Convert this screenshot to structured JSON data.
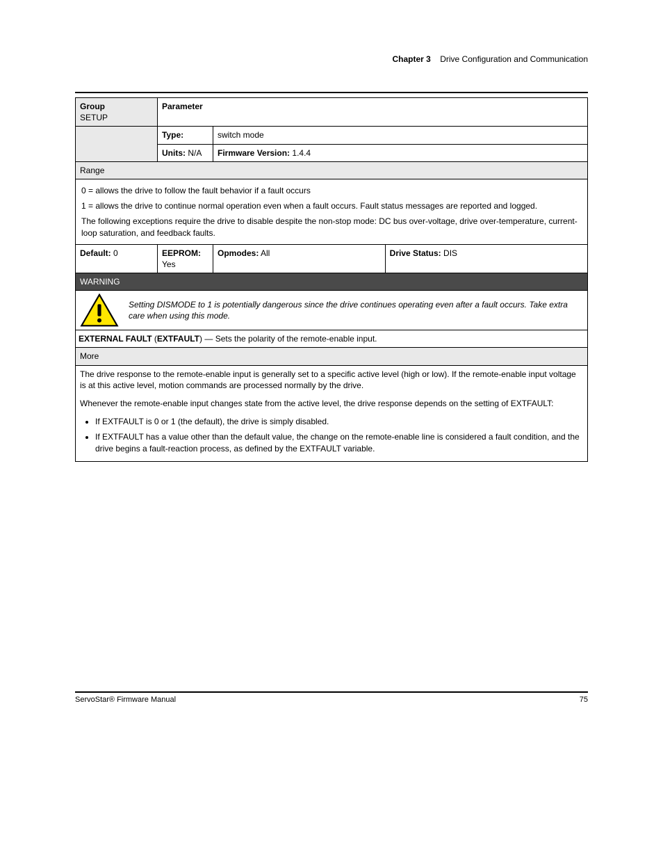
{
  "header": {
    "chapter": "Chapter 3",
    "title": "Drive Configuration and Communication"
  },
  "rows": {
    "group_label": "Group",
    "group_value": "SETUP",
    "param_label": "Parameter",
    "type_label": "Type:",
    "type_value": "switch mode",
    "units_label": "Units:",
    "units_value": "N/A",
    "fw_label": "Firmware Version:",
    "fw_value": "1.4.4",
    "range_heading": "Range",
    "range_lines": [
      "0 = allows the drive to follow the fault behavior if a fault occurs",
      "1 = allows the drive to continue normal operation even when a fault occurs. Fault status messages are reported and logged.",
      "The following exceptions require the drive to disable despite the non-stop mode: DC bus over-voltage, drive over-temperature, current-loop saturation, and feedback faults."
    ],
    "default_label": "Default:",
    "default_value": "0",
    "eeprom_label": "EEPROM:",
    "eeprom_value": "Yes",
    "opmodes_label": "Opmodes:",
    "opmodes_value": "All",
    "drivestatus_label": "Drive Status:",
    "drivestatus_value": "DIS"
  },
  "warning": {
    "heading": "WARNING",
    "text": "Setting DISMODE to 1 is potentially dangerous since the drive continues operating even after a fault occurs. Take extra care when using this mode."
  },
  "extfault": {
    "heading": "EXTERNAL FAULT",
    "name": "EXTFAULT",
    "description": "Sets the polarity of the remote-enable input.",
    "more_heading": "More",
    "more_intro": "The drive response to the remote-enable input is generally set to a specific active level (high or low). If the remote-enable input voltage is at this active level, motion commands are processed normally by the drive.",
    "more_followup": "Whenever the remote-enable input changes state from the active level, the drive response depends on the setting of EXTFAULT:",
    "bullets": [
      "If EXTFAULT is 0 or 1 (the default), the drive is simply disabled.",
      "If EXTFAULT has a value other than the default value, the change on the remote-enable line is considered a fault condition, and the drive begins a fault-reaction process, as defined by the EXTFAULT variable."
    ]
  },
  "footer": {
    "left": "ServoStar® Firmware Manual",
    "right": "75"
  }
}
